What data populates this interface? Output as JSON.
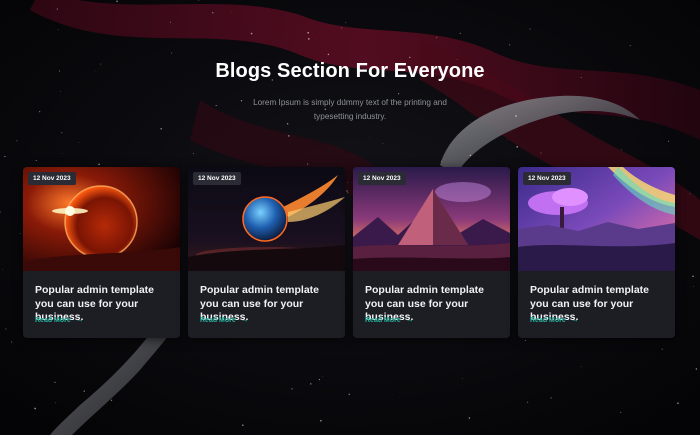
{
  "section": {
    "title": "Blogs Section For Everyone",
    "subtitle": "Lorem Ipsum is simply dummy text of the printing and typesetting industry."
  },
  "cards": [
    {
      "date": "12 Nov 2023",
      "title": "Popular admin template you can use for your business.",
      "link": "Read More",
      "image": "red-planet-image"
    },
    {
      "date": "12 Nov 2023",
      "title": "Popular admin template you can use for your business.",
      "link": "Read More",
      "image": "planet-explosion-image"
    },
    {
      "date": "12 Nov 2023",
      "title": "Popular admin template you can use for your business.",
      "link": "Read More",
      "image": "pyramid-image"
    },
    {
      "date": "12 Nov 2023",
      "title": "Popular admin template you can use for your business.",
      "link": "Read More",
      "image": "fantasy-tree-image"
    }
  ],
  "colors": {
    "background": "#07070b",
    "card": "#1d1e24",
    "accent": "#27b3a0",
    "heading": "#ffffff",
    "muted": "#8f929a"
  },
  "icons": [
    "arrow-right-icon"
  ]
}
